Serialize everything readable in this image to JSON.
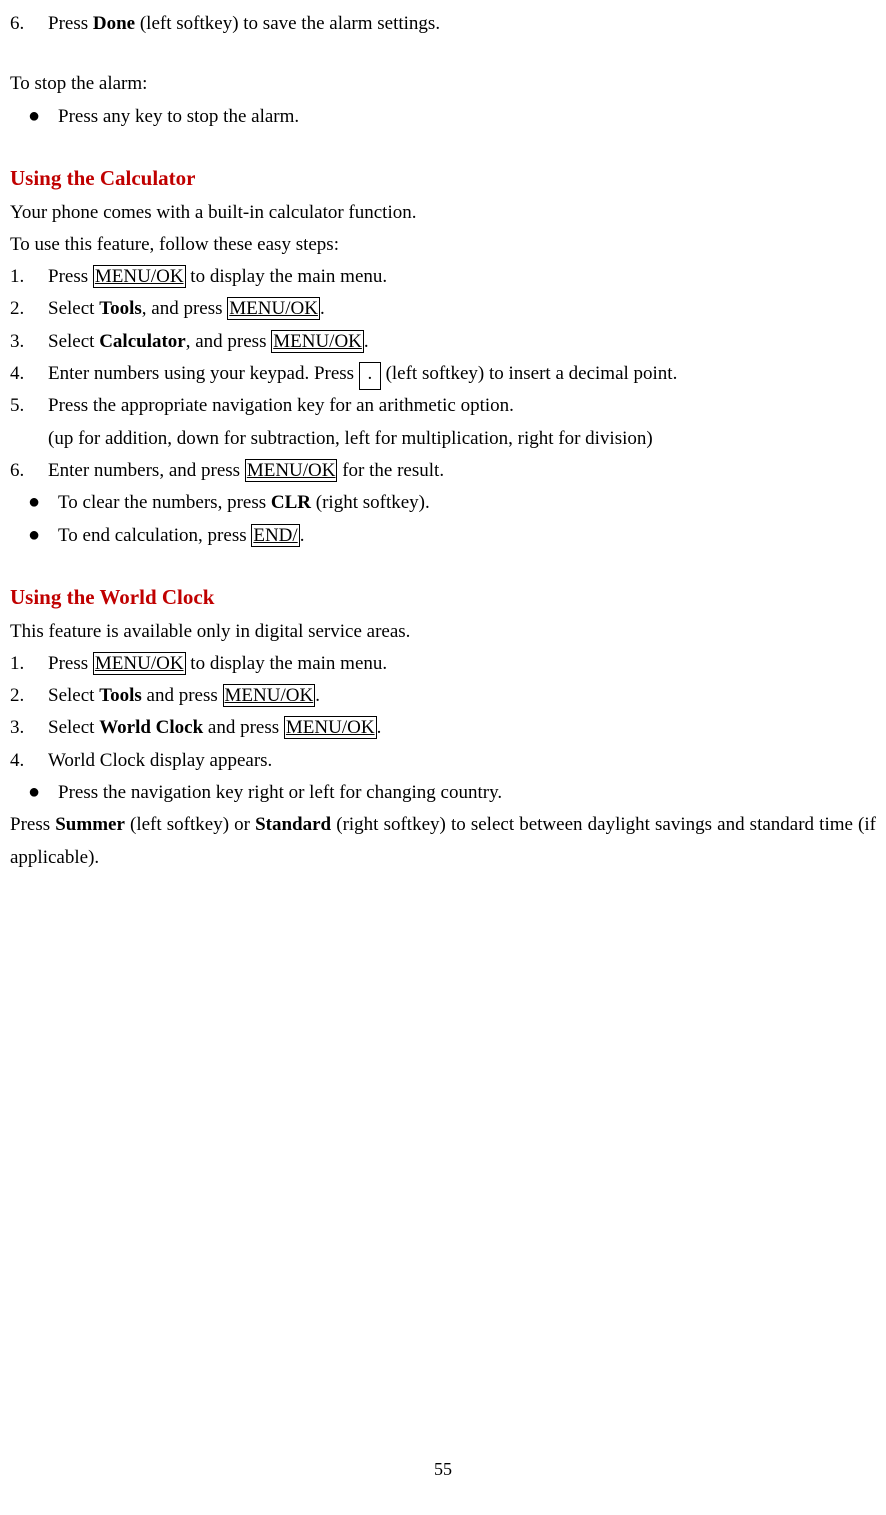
{
  "step6": {
    "num": "6.",
    "t1": "Press ",
    "done": "Done",
    "t2": " (left softkey) to save the alarm settings."
  },
  "stopAlarm": {
    "intro": "To stop the alarm:",
    "b1": "Press any key to stop the alarm."
  },
  "calc": {
    "heading": "Using the Calculator",
    "intro1": "Your phone comes with a built-in calculator function.",
    "intro2": "To use this feature, follow these easy steps:",
    "s1": {
      "num": "1.",
      "a": "Press ",
      "key": "MENU/OK",
      "b": " to display the main menu."
    },
    "s2": {
      "num": "2.",
      "a": "Select ",
      "tools": "Tools",
      "b": ", and press ",
      "key": "MENU/OK",
      "c": "."
    },
    "s3": {
      "num": "3.",
      "a": "Select ",
      "calc": "Calculator",
      "b": ", and press ",
      "key": "MENU/OK",
      "c": "."
    },
    "s4": {
      "num": "4.",
      "a": "Enter numbers using your keypad. Press ",
      "dot": ".",
      "b": " (left softkey) to insert a decimal point."
    },
    "s5": {
      "num": "5.",
      "a": "Press the appropriate navigation key for an arithmetic option."
    },
    "s5b": "(up for addition, down for subtraction, left for multiplication, right for division)",
    "s6": {
      "num": "6.",
      "a": "Enter numbers, and press ",
      "key": "MENU/OK",
      "b": " for the result."
    },
    "b1": {
      "a": "To clear the numbers, press ",
      "clr": "CLR",
      "b": " (right softkey)."
    },
    "b2": {
      "a": "To end calculation, press ",
      "key": "END/",
      "b": "."
    }
  },
  "world": {
    "heading": "Using the World Clock",
    "intro": "This feature is available only in digital service areas.",
    "s1": {
      "num": "1.",
      "a": "Press ",
      "key": "MENU/OK",
      "b": " to display the main menu."
    },
    "s2": {
      "num": "2.",
      "a": "Select ",
      "tools": "Tools",
      "b": " and press ",
      "key": "MENU/OK",
      "c": "."
    },
    "s3": {
      "num": "3.",
      "a": "Select ",
      "wc": "World Clock",
      "b": " and press ",
      "key": "MENU/OK",
      "c": "."
    },
    "s4": {
      "num": "4.",
      "a": "World Clock display appears."
    },
    "b1": "Press the navigation key right or left for changing country.",
    "final": {
      "a": "Press ",
      "summer": "Summer",
      "b": " (left softkey) or ",
      "standard": "Standard",
      "c": " (right softkey) to select between daylight savings and standard time (if applicable)."
    }
  },
  "page": "55"
}
